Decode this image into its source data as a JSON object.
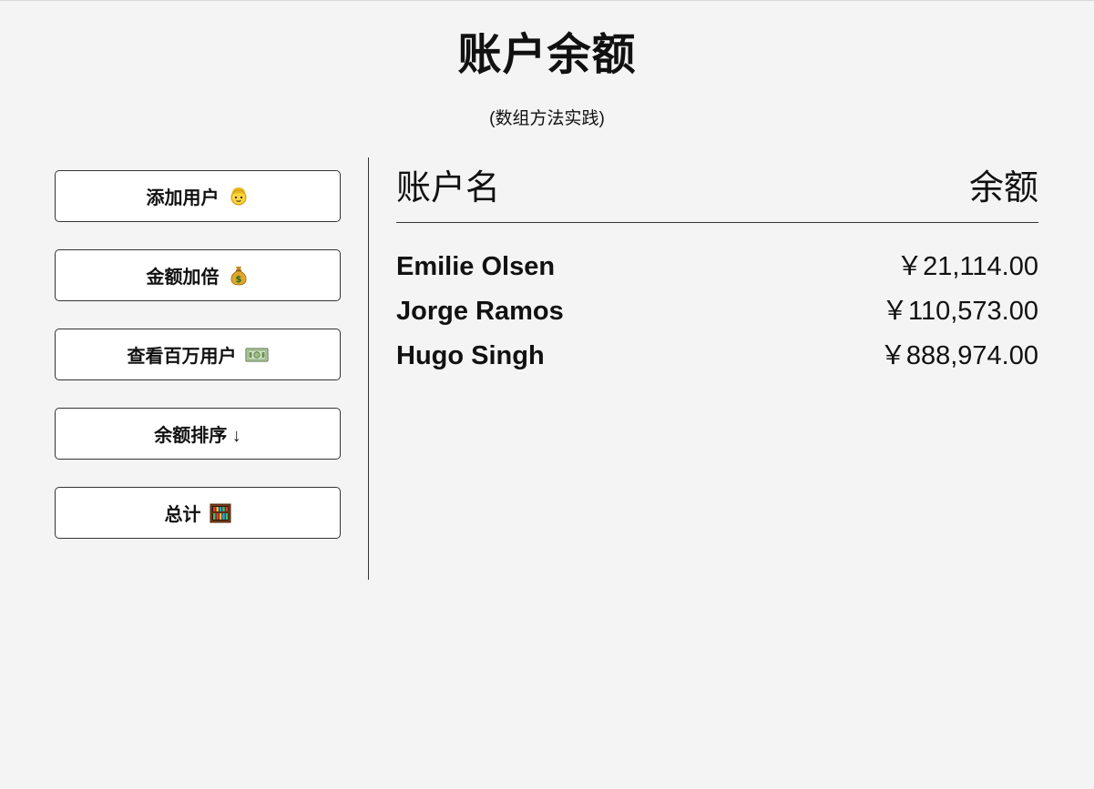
{
  "header": {
    "title": "账户余额",
    "subtitle": "(数组方法实践)"
  },
  "sidebar": {
    "buttons": [
      {
        "label": "添加用户",
        "icon": "person-face-icon"
      },
      {
        "label": "金额加倍",
        "icon": "money-bag-icon"
      },
      {
        "label": "查看百万用户",
        "icon": "dollar-banknote-icon"
      },
      {
        "label": "余额排序 ↓",
        "icon": ""
      },
      {
        "label": "总计",
        "icon": "abacus-icon"
      }
    ]
  },
  "table": {
    "headers": {
      "name": "账户名",
      "balance": "余额"
    },
    "rows": [
      {
        "name": "Emilie Olsen",
        "balance": "￥21,114.00"
      },
      {
        "name": "Jorge Ramos",
        "balance": "￥110,573.00"
      },
      {
        "name": "Hugo Singh",
        "balance": "￥888,974.00"
      }
    ]
  },
  "colors": {
    "background": "#f4f4f4",
    "button_background": "#ffffff",
    "border": "#333333",
    "text": "#111111"
  }
}
